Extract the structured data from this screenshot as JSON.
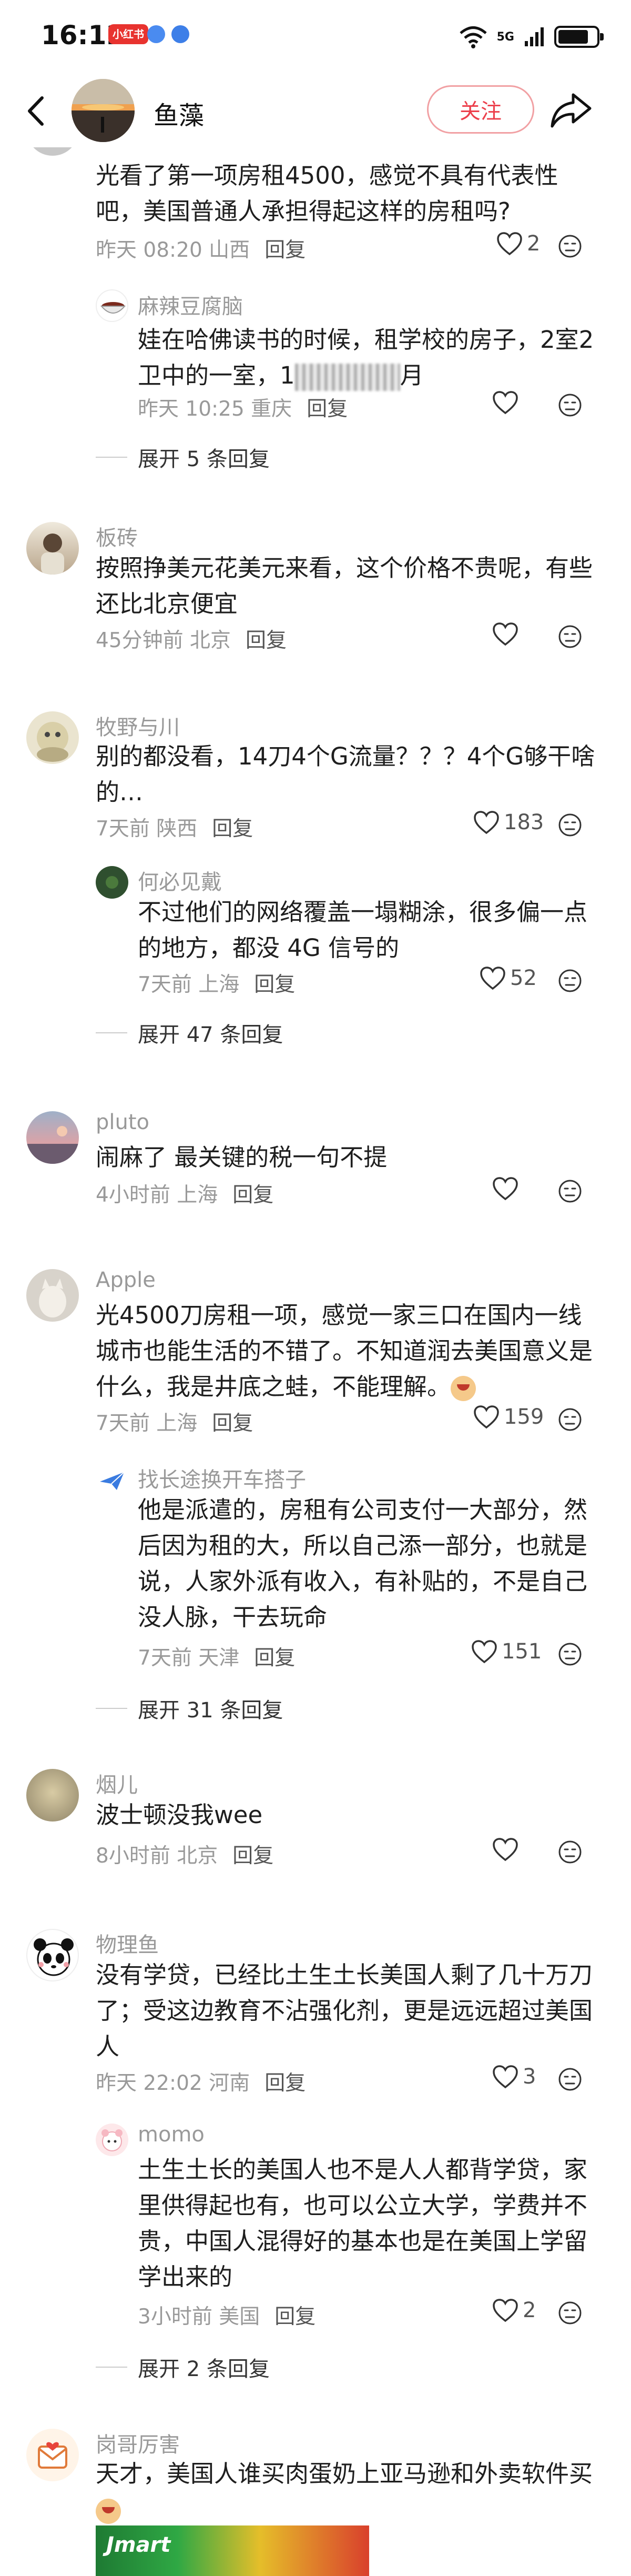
{
  "status": {
    "time": "16:12",
    "badge": "小红书",
    "network": "5G"
  },
  "nav": {
    "title": "鱼藻",
    "follow_label": "关注"
  },
  "comments": [
    {
      "text": "光看了第一项房租4500，感觉不具有代表性吧，美国普通人承担得起这样的房租吗?",
      "time_loc": "昨天 08:20 山西",
      "reply": "回复",
      "likes": "2",
      "replies": [
        {
          "author": "麻辣豆腐脑",
          "text_a": "娃在哈佛读书的时候，租学校的房子，2室2卫中的一室，1",
          "text_b": "月",
          "time_loc": "昨天 10:25 重庆",
          "reply": "回复",
          "likes": ""
        }
      ],
      "expand": "展开 5 条回复"
    },
    {
      "author": "板砖",
      "text": "按照挣美元花美元来看，这个价格不贵呢，有些还比北京便宜",
      "time_loc": "45分钟前 北京",
      "reply": "回复",
      "likes": ""
    },
    {
      "author": "牧野与川",
      "text": "别的都没看，14刀4个G流量？？？4个G够干啥的…",
      "time_loc": "7天前 陕西",
      "reply": "回复",
      "likes": "183",
      "replies": [
        {
          "author": "何必见戴",
          "text": "不过他们的网络覆盖一塌糊涂，很多偏一点的地方，都没 4G 信号的",
          "time_loc": "7天前 上海",
          "reply": "回复",
          "likes": "52"
        }
      ],
      "expand": "展开 47 条回复"
    },
    {
      "author": "pluto",
      "text": "闹麻了 最关键的税一句不提",
      "time_loc": "4小时前 上海",
      "reply": "回复",
      "likes": ""
    },
    {
      "author": "Apple",
      "text": "光4500刀房租一项，感觉一家三口在国内一线城市也能生活的不错了。不知道润去美国意义是什么，我是井底之蛙，不能理解。",
      "time_loc": "7天前 上海",
      "reply": "回复",
      "likes": "159",
      "replies": [
        {
          "author": "找长途换开车搭子",
          "text": "他是派遣的，房租有公司支付一大部分，然后因为租的大，所以自己添一部分，也就是说，人家外派有收入，有补贴的，不是自己没人脉，干去玩命",
          "time_loc": "7天前 天津",
          "reply": "回复",
          "likes": "151"
        }
      ],
      "expand": "展开 31 条回复"
    },
    {
      "author": "烟儿",
      "text": "波士顿没我wee",
      "time_loc": "8小时前 北京",
      "reply": "回复",
      "likes": ""
    },
    {
      "author": "物理鱼",
      "text": "没有学贷，已经比土生土长美国人剩了几十万刀了；受这边教育不沾强化剂，更是远远超过美国人",
      "time_loc": "昨天 22:02 河南",
      "reply": "回复",
      "likes": "3",
      "replies": [
        {
          "author": "momo",
          "text": "土生土长的美国人也不是人人都背学贷，家里供得起也有，也可以公立大学，学费并不贵，中国人混得好的基本也是在美国上学留学出来的",
          "time_loc": "3小时前 美国",
          "reply": "回复",
          "likes": "2"
        }
      ],
      "expand": "展开 2 条回复"
    },
    {
      "author": "岗哥厉害",
      "text": "天才，美国人谁买肉蛋奶上亚马逊和外卖软件买"
    }
  ],
  "ad": {
    "text": "Jmart"
  }
}
